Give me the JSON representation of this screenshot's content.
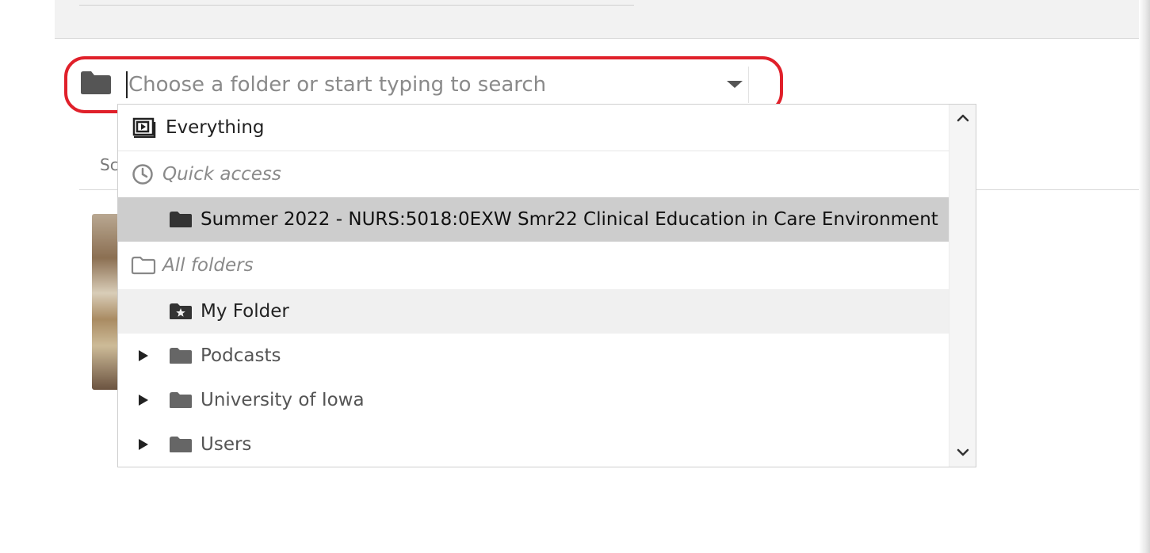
{
  "search": {
    "placeholder": "Choose a folder or start typing to search"
  },
  "background": {
    "partial_text": "Sc"
  },
  "dropdown": {
    "everything_label": "Everything",
    "quick_access_label": "Quick access",
    "quick_access_items": [
      {
        "label": "Summer 2022 - NURS:5018:0EXW Smr22 Clinical Education in Care Environment",
        "selected": true
      }
    ],
    "all_folders_label": "All folders",
    "my_folder_label": "My Folder",
    "folders": [
      {
        "label": "Podcasts",
        "expandable": true
      },
      {
        "label": "University of Iowa",
        "expandable": true
      },
      {
        "label": "Users",
        "expandable": true
      }
    ]
  },
  "colors": {
    "highlight_ring": "#e0202a",
    "selected_row": "#cdcdcd",
    "hover_row": "#f0f0f0",
    "folder_icon": "#555555"
  },
  "icons": {
    "picker": "folder-icon",
    "everything": "everything-icon",
    "quick_access": "clock-icon",
    "all_folders": "folder-outline-icon",
    "my_folder": "star-folder-icon",
    "expand": "triangle-right-icon",
    "dropdown": "caret-down-icon",
    "scroll_up": "chevron-up-icon",
    "scroll_down": "chevron-down-icon"
  }
}
